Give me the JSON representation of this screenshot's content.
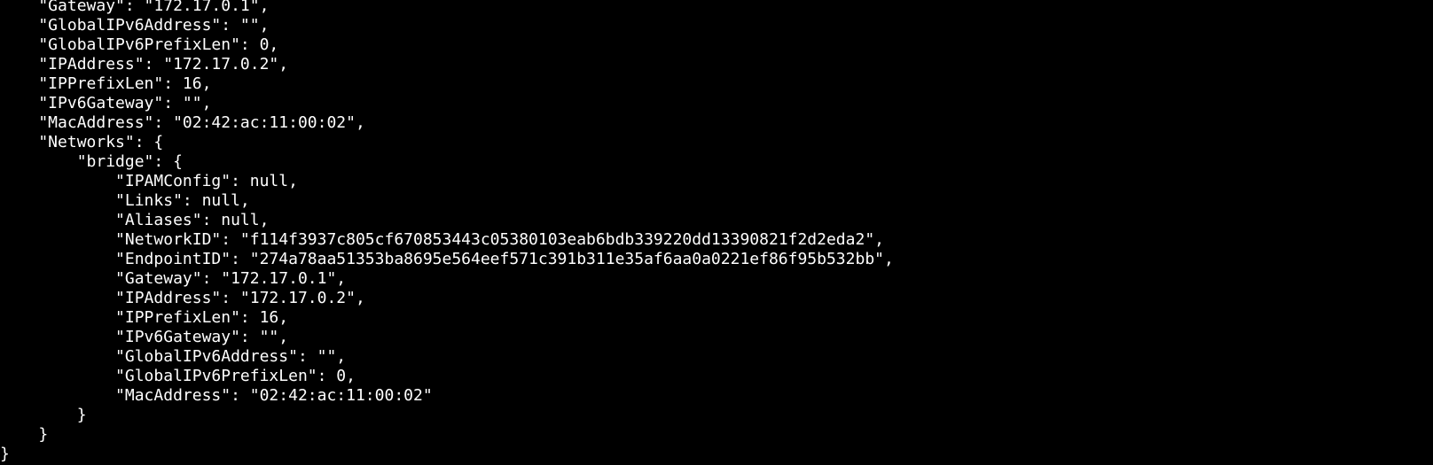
{
  "terminal": {
    "lines": [
      "    \"Gateway\": \"172.17.0.1\",",
      "    \"GlobalIPv6Address\": \"\",",
      "    \"GlobalIPv6PrefixLen\": 0,",
      "    \"IPAddress\": \"172.17.0.2\",",
      "    \"IPPrefixLen\": 16,",
      "    \"IPv6Gateway\": \"\",",
      "    \"MacAddress\": \"02:42:ac:11:00:02\",",
      "    \"Networks\": {",
      "        \"bridge\": {",
      "            \"IPAMConfig\": null,",
      "            \"Links\": null,",
      "            \"Aliases\": null,",
      "            \"NetworkID\": \"f114f3937c805cf670853443c05380103eab6bdb339220dd13390821f2d2eda2\",",
      "            \"EndpointID\": \"274a78aa51353ba8695e564eef571c391b311e35af6aa0a0221ef86f95b532bb\",",
      "            \"Gateway\": \"172.17.0.1\",",
      "            \"IPAddress\": \"172.17.0.2\",",
      "            \"IPPrefixLen\": 16,",
      "            \"IPv6Gateway\": \"\",",
      "            \"GlobalIPv6Address\": \"\",",
      "            \"GlobalIPv6PrefixLen\": 0,",
      "            \"MacAddress\": \"02:42:ac:11:00:02\"",
      "        }",
      "    }",
      "}"
    ]
  }
}
